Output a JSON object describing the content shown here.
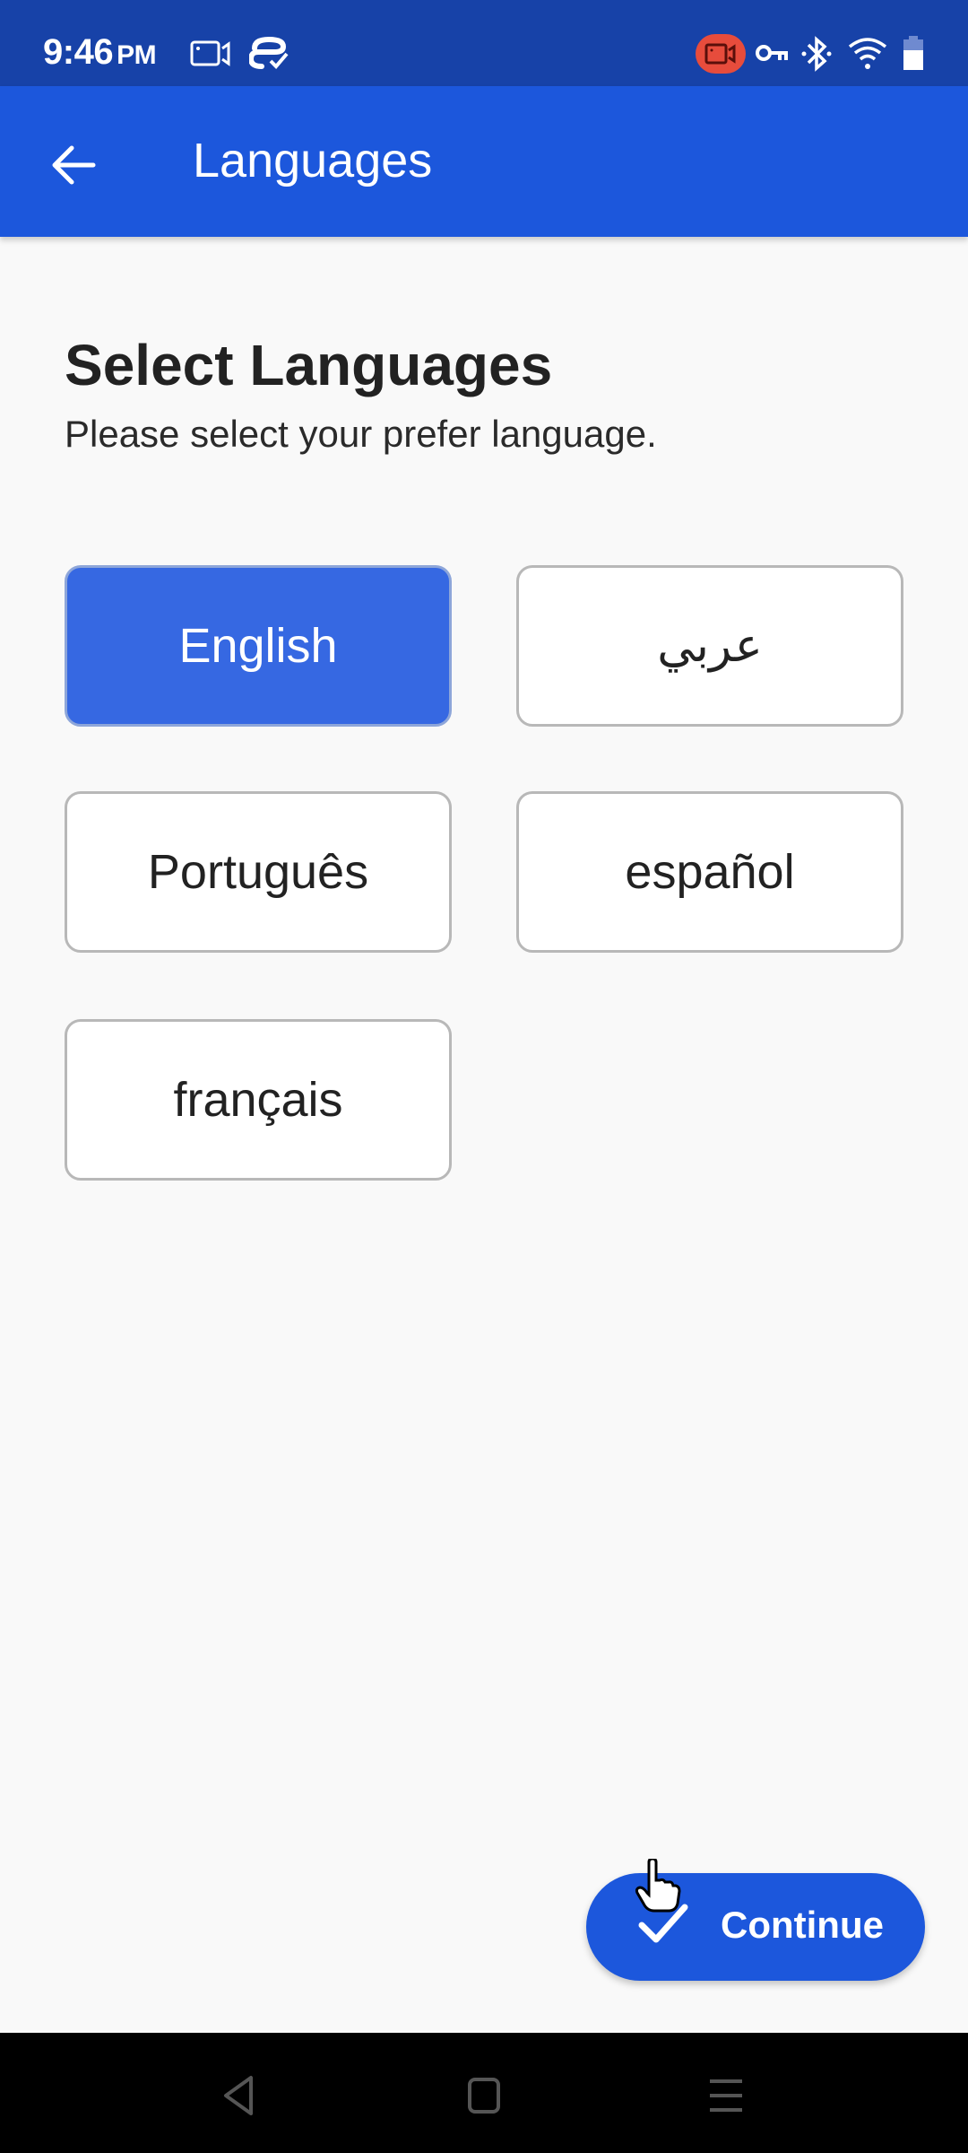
{
  "status_bar": {
    "time": "9:46",
    "ampm": "PM",
    "icons": [
      "screen-record-icon",
      "sync-check-icon",
      "recording-active-icon",
      "vpn-key-icon",
      "bluetooth-icon",
      "wifi-icon",
      "battery-icon"
    ],
    "record_color": "#e74c3c"
  },
  "app_bar": {
    "title": "Languages",
    "back_icon": "arrow-left-icon",
    "color": "#1c57dc"
  },
  "page": {
    "heading": "Select Languages",
    "subheading": "Please select your prefer language."
  },
  "languages": [
    {
      "label": "English",
      "selected": true
    },
    {
      "label": "عربي",
      "selected": false
    },
    {
      "label": "Português",
      "selected": false
    },
    {
      "label": "español",
      "selected": false
    },
    {
      "label": "français",
      "selected": false
    }
  ],
  "continue_button": {
    "label": "Continue",
    "icon": "check-icon"
  },
  "nav_bar": {
    "buttons": [
      "back",
      "home",
      "recents"
    ]
  }
}
